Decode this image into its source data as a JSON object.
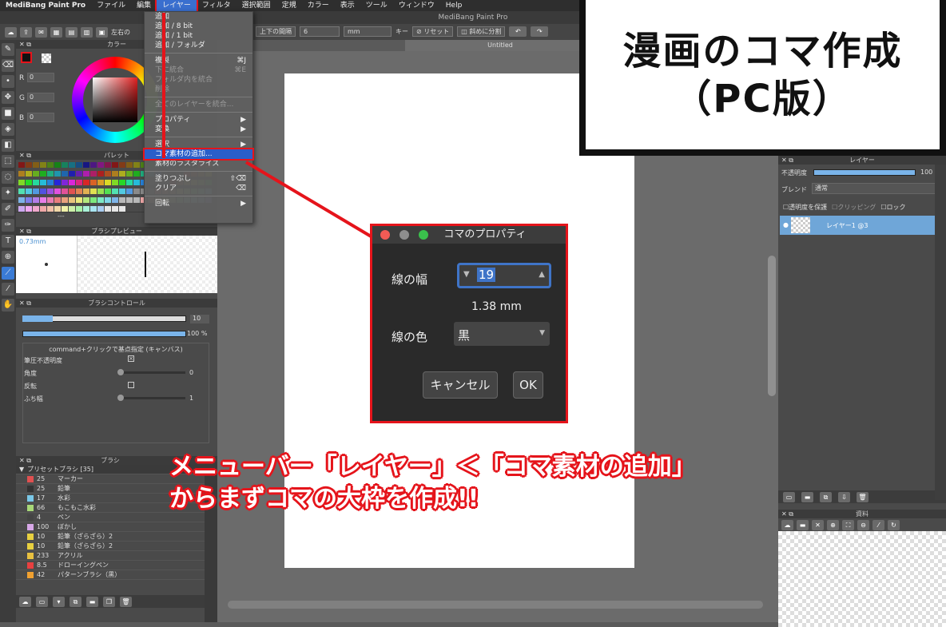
{
  "menubar": {
    "items": [
      "MediBang Paint Pro",
      "ファイル",
      "編集",
      "レイヤー",
      "フィルタ",
      "選択範囲",
      "定規",
      "カラー",
      "表示",
      "ツール",
      "ウィンドウ",
      "Help"
    ]
  },
  "window": {
    "title": "MediBang Paint Pro",
    "tab": "Untitled"
  },
  "toolbar": {
    "left_label": "左右の",
    "spacing_label": "上下の間隔",
    "spacing_value": "6",
    "unit": "mm",
    "key_label": "キー",
    "reset": "リセット",
    "diag_split": "斜めに分割"
  },
  "layer_menu": {
    "items": [
      {
        "label": "追加",
        "shortcut": "",
        "disabled": false
      },
      {
        "label": "追加 / 8 bit",
        "shortcut": "",
        "disabled": false
      },
      {
        "label": "追加 / 1 bit",
        "shortcut": "",
        "disabled": false
      },
      {
        "label": "追加 / フォルダ",
        "shortcut": "",
        "disabled": false
      },
      {
        "sep": true
      },
      {
        "label": "複製",
        "shortcut": "⌘J",
        "disabled": false
      },
      {
        "label": "下に統合",
        "shortcut": "⌘E",
        "disabled": true
      },
      {
        "label": "フォルダ内を統合",
        "shortcut": "",
        "disabled": true
      },
      {
        "label": "削除",
        "shortcut": "",
        "disabled": true
      },
      {
        "sep": true
      },
      {
        "label": "全てのレイヤーを統合...",
        "shortcut": "",
        "disabled": true
      },
      {
        "sep": true
      },
      {
        "label": "プロパティ",
        "shortcut": "▶",
        "disabled": false
      },
      {
        "label": "変換",
        "shortcut": "▶",
        "disabled": false
      },
      {
        "sep": true
      },
      {
        "label": "選択",
        "shortcut": "▶",
        "disabled": false
      },
      {
        "label": "コマ素材の追加...",
        "shortcut": "",
        "disabled": false,
        "highlight": true
      },
      {
        "label": "素材のラスタライズ",
        "shortcut": "",
        "disabled": false
      },
      {
        "sep": true
      },
      {
        "label": "塗りつぶし",
        "shortcut": "⇧⌫",
        "disabled": false
      },
      {
        "label": "クリア",
        "shortcut": "⌫",
        "disabled": false
      },
      {
        "sep": true
      },
      {
        "label": "回転",
        "shortcut": "▶",
        "disabled": false
      }
    ]
  },
  "color_panel": {
    "title": "カラー",
    "r_label": "R",
    "g_label": "G",
    "b_label": "B",
    "r": "0",
    "g": "0",
    "b": "0"
  },
  "palette_panel": {
    "title": "パレット",
    "footer": "---"
  },
  "brush_preview": {
    "title": "ブラシプレビュー",
    "size": "0.73mm"
  },
  "brush_control": {
    "title": "ブラシコントロール",
    "size_value": "10",
    "opacity_value": "100 %",
    "hint": "command+クリックで基点指定 (キャンバス)",
    "pressure_label": "筆圧不透明度",
    "angle_label": "角度",
    "angle_value": "0",
    "flip_label": "反転",
    "border_label": "ふち幅",
    "border_value": "1"
  },
  "brush_panel": {
    "title": "ブラシ",
    "group": "プリセットブラシ [35]",
    "items": [
      {
        "size": "25",
        "name": "マーカー",
        "color": "#e05050"
      },
      {
        "size": "25",
        "name": "鉛筆",
        "color": "#333333"
      },
      {
        "size": "17",
        "name": "水彩",
        "color": "#7ac8e8"
      },
      {
        "size": "66",
        "name": "もこもこ水彩",
        "color": "#a8d878"
      },
      {
        "size": "4",
        "name": "ペン",
        "color": "#444444"
      },
      {
        "size": "100",
        "name": "ぼかし",
        "color": "#d8a8e8"
      },
      {
        "size": "10",
        "name": "鉛筆（ざらざら）2",
        "color": "#e8d040"
      },
      {
        "size": "10",
        "name": "鉛筆（ざらざら）2",
        "color": "#e8d040"
      },
      {
        "size": "233",
        "name": "アクリル",
        "color": "#e8c040"
      },
      {
        "size": "8.5",
        "name": "ドローイングペン",
        "color": "#e84040"
      },
      {
        "size": "42",
        "name": "パターンブラシ（黒）",
        "color": "#f0a030"
      }
    ]
  },
  "layer_panel": {
    "title": "レイヤー",
    "opacity_label": "不透明度",
    "opacity_value": "100 %",
    "blend_label": "ブレンド",
    "blend_value": "通常",
    "protect_label": "透明度を保護",
    "clip_label": "クリッピング",
    "lock_label": "ロック",
    "layer_name": "レイヤー1 @3"
  },
  "material_panel": {
    "title": "資料"
  },
  "dialog": {
    "title": "コマのプロパティ",
    "width_label": "線の幅",
    "width_value": "19",
    "mm_value": "1.38 mm",
    "color_label": "線の色",
    "color_value": "黒",
    "cancel": "キャンセル",
    "ok": "OK"
  },
  "callout": {
    "line1": "漫画のコマ作成",
    "line2": "（PC版）"
  },
  "annotation": {
    "line1": "メニューバー「レイヤー」＜「コマ素材の追加」",
    "line2": "からまずコマの大枠を作成!!"
  },
  "colors": {
    "accent_red": "#e5141b",
    "menu_highlight": "#2a5ec9",
    "layer_selected": "#6fa6d8"
  }
}
